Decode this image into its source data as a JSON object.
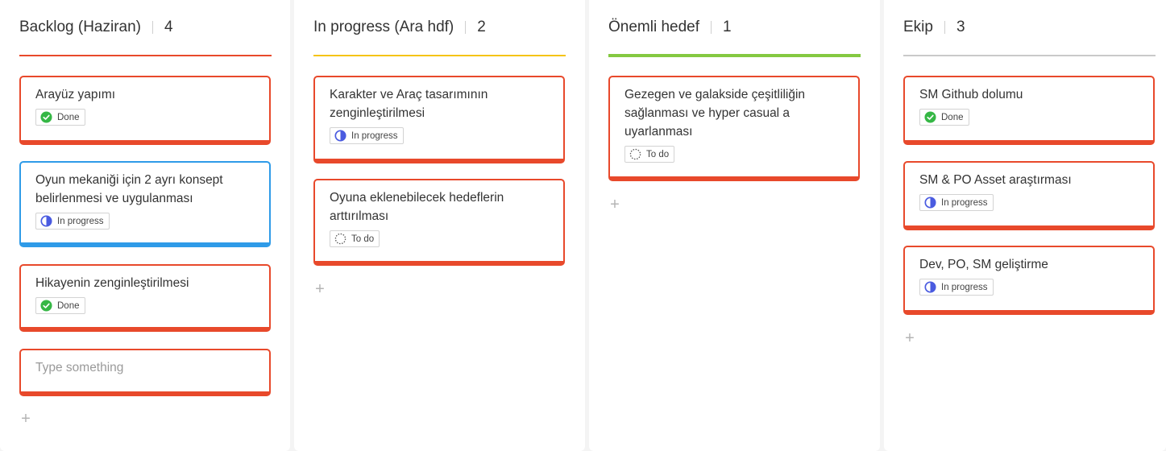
{
  "colors": {
    "card_border_default": "#e8492b",
    "card_border_selected": "#2f9be8",
    "done_green": "#35b745",
    "progress_blue": "#4a5be0",
    "rule_red": "#e8492b",
    "rule_yellow": "#f5c417",
    "rule_green": "#84c941",
    "rule_grey": "#c9c9c9"
  },
  "columns": [
    {
      "title": "Backlog (Haziran)",
      "count": "4",
      "rule_color": "#e8492b",
      "cards": [
        {
          "title": "Arayüz yapımı",
          "status": "Done"
        },
        {
          "title": "Oyun mekaniği için 2 ayrı konsept belirlenmesi ve uygulanması",
          "status": "In progress",
          "selected": true
        },
        {
          "title": "Hikayenin zenginleştirilmesi",
          "status": "Done"
        },
        {
          "title": "Type something",
          "placeholder": true
        }
      ],
      "add_label": "+"
    },
    {
      "title": "In progress (Ara hdf)",
      "count": "2",
      "rule_color": "#f5c417",
      "cards": [
        {
          "title": "Karakter ve Araç tasarımının zenginleştirilmesi",
          "status": "In progress"
        },
        {
          "title": "Oyuna eklenebilecek hedeflerin arttırılması",
          "status": "To do"
        }
      ],
      "add_label": "+"
    },
    {
      "title": "Önemli hedef",
      "count": "1",
      "rule_color": "#84c941",
      "cards": [
        {
          "title": "Gezegen ve galakside çeşitliliğin sağlanması ve hyper casual a uyarlanması",
          "status": "To do"
        }
      ],
      "add_label": "+"
    },
    {
      "title": "Ekip",
      "count": "3",
      "rule_color": "#c9c9c9",
      "cards": [
        {
          "title": "SM Github dolumu",
          "status": "Done"
        },
        {
          "title": "SM & PO Asset araştırması",
          "status": "In progress"
        },
        {
          "title": "Dev, PO, SM geliştirme",
          "status": "In progress"
        }
      ],
      "add_label": "+"
    }
  ]
}
